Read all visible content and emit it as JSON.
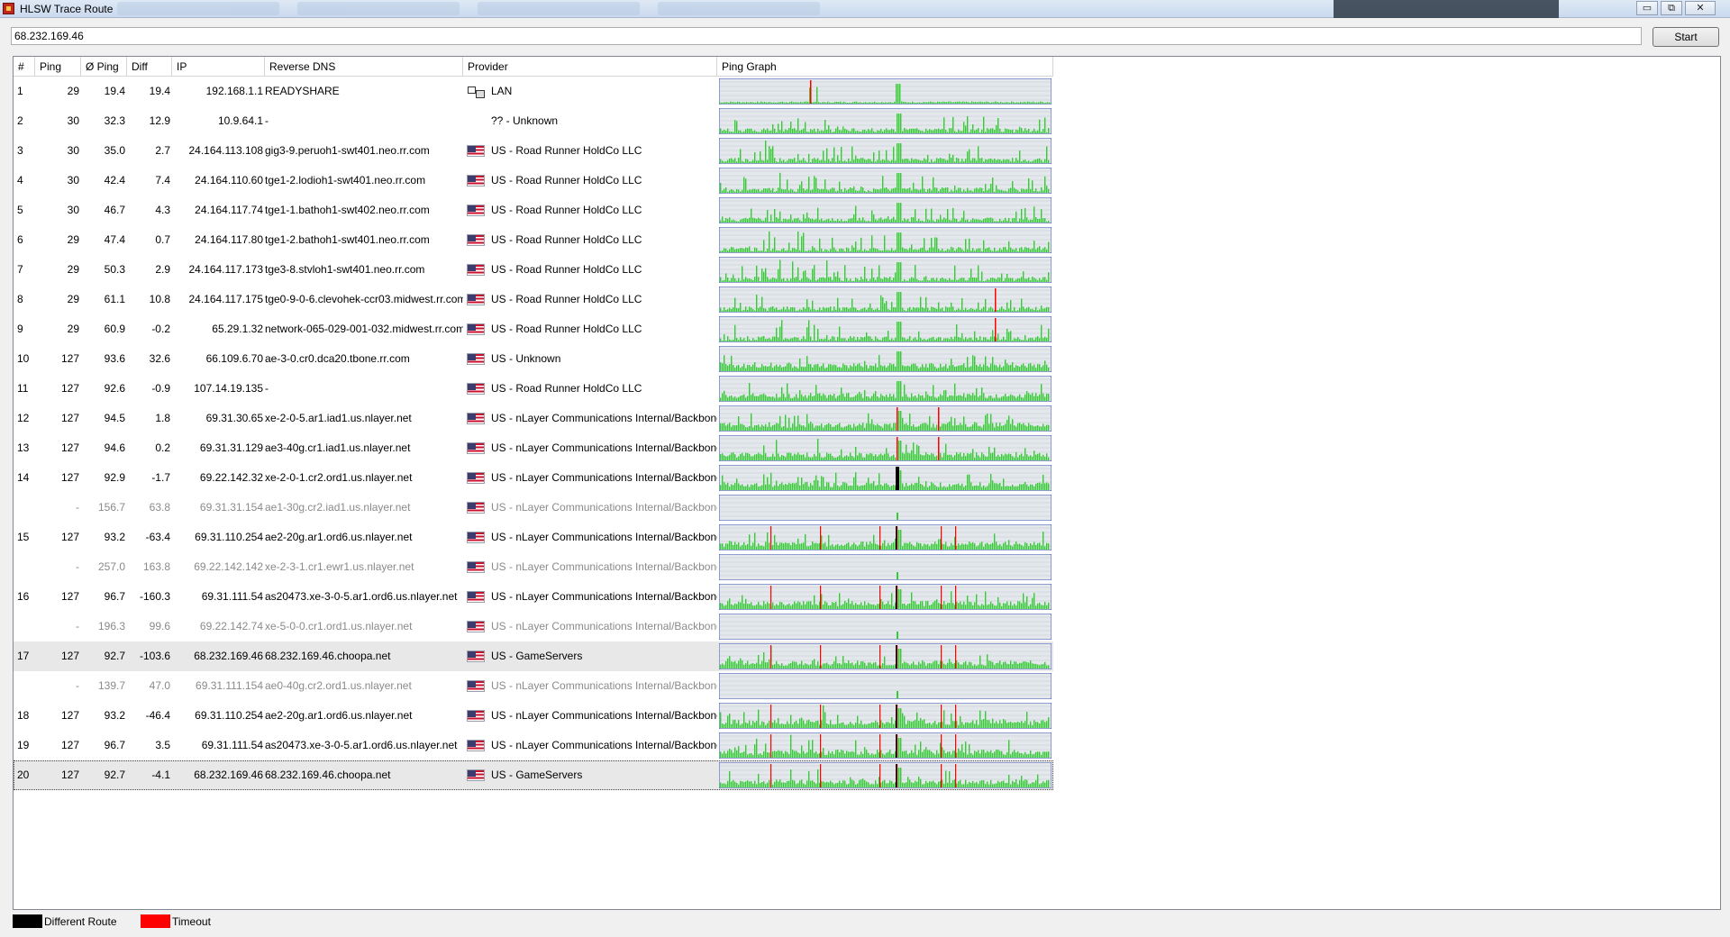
{
  "window": {
    "title": "HLSW Trace Route",
    "minimize": "▭",
    "maximize": "⧉",
    "close": "✕"
  },
  "toolbar": {
    "address_value": "68.232.169.46",
    "start_label": "Start"
  },
  "columns": {
    "hop": "#",
    "ping": "Ping",
    "avg_ping": "Ø Ping",
    "diff": "Diff",
    "ip": "IP",
    "reverse_dns": "Reverse DNS",
    "provider": "Provider",
    "ping_graph": "Ping Graph"
  },
  "hops": [
    {
      "hop": "1",
      "ping": "29",
      "avg": "19.4",
      "diff": "19.4",
      "ip": "192.168.1.1",
      "rdns": "READYSHARE",
      "provider": "LAN",
      "icon": "lan-icon",
      "style": "sparse-low",
      "spike": "red-left"
    },
    {
      "hop": "2",
      "ping": "30",
      "avg": "32.3",
      "diff": "12.9",
      "ip": "10.9.64.1",
      "rdns": "-",
      "provider": "?? - Unknown",
      "icon": "none",
      "style": "sparse",
      "spike": "none"
    },
    {
      "hop": "3",
      "ping": "30",
      "avg": "35.0",
      "diff": "2.7",
      "ip": "24.164.113.108",
      "rdns": "gig3-9.peruoh1-swt401.neo.rr.com",
      "provider": "US - Road Runner HoldCo LLC",
      "icon": "us-flag-icon",
      "style": "sparse",
      "spike": "none"
    },
    {
      "hop": "4",
      "ping": "30",
      "avg": "42.4",
      "diff": "7.4",
      "ip": "24.164.110.60",
      "rdns": "tge1-2.lodioh1-swt401.neo.rr.com",
      "provider": "US - Road Runner HoldCo LLC",
      "icon": "us-flag-icon",
      "style": "sparse",
      "spike": "none"
    },
    {
      "hop": "5",
      "ping": "30",
      "avg": "46.7",
      "diff": "4.3",
      "ip": "24.164.117.74",
      "rdns": "tge1-1.bathoh1-swt402.neo.rr.com",
      "provider": "US - Road Runner HoldCo LLC",
      "icon": "us-flag-icon",
      "style": "sparse",
      "spike": "none"
    },
    {
      "hop": "6",
      "ping": "29",
      "avg": "47.4",
      "diff": "0.7",
      "ip": "24.164.117.80",
      "rdns": "tge1-2.bathoh1-swt401.neo.rr.com",
      "provider": "US - Road Runner HoldCo LLC",
      "icon": "us-flag-icon",
      "style": "sparse",
      "spike": "none"
    },
    {
      "hop": "7",
      "ping": "29",
      "avg": "50.3",
      "diff": "2.9",
      "ip": "24.164.117.173",
      "rdns": "tge3-8.stvloh1-swt401.neo.rr.com",
      "provider": "US - Road Runner HoldCo LLC",
      "icon": "us-flag-icon",
      "style": "sparse",
      "spike": "none"
    },
    {
      "hop": "8",
      "ping": "29",
      "avg": "61.1",
      "diff": "10.8",
      "ip": "24.164.117.175",
      "rdns": "tge0-9-0-6.clevohek-ccr03.midwest.rr.com",
      "provider": "US - Road Runner HoldCo LLC",
      "icon": "us-flag-icon",
      "style": "sparse",
      "spike": "red-right"
    },
    {
      "hop": "9",
      "ping": "29",
      "avg": "60.9",
      "diff": "-0.2",
      "ip": "65.29.1.32",
      "rdns": "network-065-029-001-032.midwest.rr.com",
      "provider": "US - Road Runner HoldCo LLC",
      "icon": "us-flag-icon",
      "style": "sparse",
      "spike": "red-right"
    },
    {
      "hop": "10",
      "ping": "127",
      "avg": "93.6",
      "diff": "32.6",
      "ip": "66.109.6.70",
      "rdns": "ae-3-0.cr0.dca20.tbone.rr.com",
      "provider": "US - Unknown",
      "icon": "us-flag-icon",
      "style": "dense",
      "spike": "none"
    },
    {
      "hop": "11",
      "ping": "127",
      "avg": "92.6",
      "diff": "-0.9",
      "ip": "107.14.19.135",
      "rdns": "-",
      "provider": "US - Road Runner HoldCo LLC",
      "icon": "us-flag-icon",
      "style": "dense",
      "spike": "none"
    },
    {
      "hop": "12",
      "ping": "127",
      "avg": "94.5",
      "diff": "1.8",
      "ip": "69.31.30.65",
      "rdns": "xe-2-0-5.ar1.iad1.us.nlayer.net",
      "provider": "US - nLayer Communications Internal/Backbone",
      "icon": "us-flag-icon",
      "style": "dense",
      "spike": "red-mid"
    },
    {
      "hop": "13",
      "ping": "127",
      "avg": "94.6",
      "diff": "0.2",
      "ip": "69.31.31.129",
      "rdns": "ae3-40g.cr1.iad1.us.nlayer.net",
      "provider": "US - nLayer Communications Internal/Backbone",
      "icon": "us-flag-icon",
      "style": "dense",
      "spike": "red-mid"
    },
    {
      "hop": "14",
      "ping": "127",
      "avg": "92.9",
      "diff": "-1.7",
      "ip": "69.22.142.32",
      "rdns": "xe-2-0-1.cr2.ord1.us.nlayer.net",
      "provider": "US - nLayer Communications Internal/Backbone",
      "icon": "us-flag-icon",
      "style": "dense",
      "spike": "black"
    },
    {
      "hop": "",
      "ping": "-",
      "avg": "156.7",
      "diff": "63.8",
      "ip": "69.31.31.154",
      "rdns": "ae1-30g.cr2.iad1.us.nlayer.net",
      "provider": "US - nLayer Communications Internal/Backbone",
      "icon": "us-flag-icon",
      "style": "ghost",
      "spike": "none"
    },
    {
      "hop": "15",
      "ping": "127",
      "avg": "93.2",
      "diff": "-63.4",
      "ip": "69.31.110.254",
      "rdns": "ae2-20g.ar1.ord6.us.nlayer.net",
      "provider": "US - nLayer Communications Internal/Backbone",
      "icon": "us-flag-icon",
      "style": "dense",
      "spike": "red-multi"
    },
    {
      "hop": "",
      "ping": "-",
      "avg": "257.0",
      "diff": "163.8",
      "ip": "69.22.142.142",
      "rdns": "xe-2-3-1.cr1.ewr1.us.nlayer.net",
      "provider": "US - nLayer Communications Internal/Backbone",
      "icon": "us-flag-icon",
      "style": "ghost",
      "spike": "none"
    },
    {
      "hop": "16",
      "ping": "127",
      "avg": "96.7",
      "diff": "-160.3",
      "ip": "69.31.111.54",
      "rdns": "as20473.xe-3-0-5.ar1.ord6.us.nlayer.net",
      "provider": "US - nLayer Communications Internal/Backbone",
      "icon": "us-flag-icon",
      "style": "dense",
      "spike": "red-multi"
    },
    {
      "hop": "",
      "ping": "-",
      "avg": "196.3",
      "diff": "99.6",
      "ip": "69.22.142.74",
      "rdns": "xe-5-0-0.cr1.ord1.us.nlayer.net",
      "provider": "US - nLayer Communications Internal/Backbone",
      "icon": "us-flag-icon",
      "style": "ghost",
      "spike": "none"
    },
    {
      "hop": "17",
      "ping": "127",
      "avg": "92.7",
      "diff": "-103.6",
      "ip": "68.232.169.46",
      "rdns": "68.232.169.46.choopa.net",
      "provider": "US - GameServers",
      "icon": "us-flag-icon",
      "style": "dense",
      "spike": "red-multi",
      "selected": true
    },
    {
      "hop": "",
      "ping": "-",
      "avg": "139.7",
      "diff": "47.0",
      "ip": "69.31.111.154",
      "rdns": "ae0-40g.cr2.ord1.us.nlayer.net",
      "provider": "US - nLayer Communications Internal/Backbone",
      "icon": "us-flag-icon",
      "style": "ghost",
      "spike": "none"
    },
    {
      "hop": "18",
      "ping": "127",
      "avg": "93.2",
      "diff": "-46.4",
      "ip": "69.31.110.254",
      "rdns": "ae2-20g.ar1.ord6.us.nlayer.net",
      "provider": "US - nLayer Communications Internal/Backbone",
      "icon": "us-flag-icon",
      "style": "dense",
      "spike": "red-multi"
    },
    {
      "hop": "19",
      "ping": "127",
      "avg": "96.7",
      "diff": "3.5",
      "ip": "69.31.111.54",
      "rdns": "as20473.xe-3-0-5.ar1.ord6.us.nlayer.net",
      "provider": "US - nLayer Communications Internal/Backbone",
      "icon": "us-flag-icon",
      "style": "dense",
      "spike": "red-multi"
    },
    {
      "hop": "20",
      "ping": "127",
      "avg": "92.7",
      "diff": "-4.1",
      "ip": "68.232.169.46",
      "rdns": "68.232.169.46.choopa.net",
      "provider": "US - GameServers",
      "icon": "us-flag-icon",
      "style": "dense",
      "spike": "red-multi",
      "selected": true,
      "focused": true
    }
  ],
  "legend": {
    "different_route": {
      "label": "Different Route",
      "color": "#000000"
    },
    "timeout": {
      "label": "Timeout",
      "color": "#ff0000"
    }
  },
  "colors": {
    "graph_bar": "#33cc33",
    "graph_bg": "#e4e8ec",
    "graph_border": "#3a4fb0",
    "timeout": "#ff0000",
    "different_route": "#000000",
    "selected_row": "#e8e8e8"
  }
}
